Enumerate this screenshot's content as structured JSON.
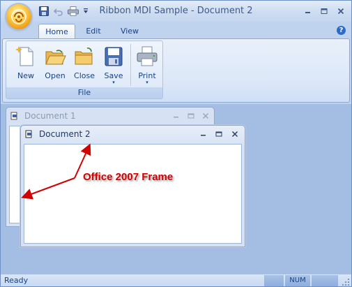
{
  "window": {
    "title": "Ribbon MDI Sample - Document 2"
  },
  "quick_access": {
    "icons": [
      "save-icon",
      "undo-icon",
      "print-icon",
      "customize-dropdown-icon"
    ]
  },
  "tabs": [
    {
      "label": "Home",
      "active": true
    },
    {
      "label": "Edit",
      "active": false
    },
    {
      "label": "View",
      "active": false
    }
  ],
  "ribbon": {
    "group_label": "File",
    "buttons": [
      {
        "label": "New",
        "icon": "new-document-icon"
      },
      {
        "label": "Open",
        "icon": "open-folder-icon"
      },
      {
        "label": "Close",
        "icon": "close-folder-icon"
      },
      {
        "label": "Save",
        "icon": "save-disk-icon",
        "dropdown": "▾"
      },
      {
        "label": "Print",
        "icon": "printer-icon",
        "dropdown": "▾"
      }
    ]
  },
  "mdi": {
    "doc1_title": "Document 1",
    "doc2_title": "Document 2",
    "annotation": "Office 2007 Frame",
    "annotation_color": "#d40000"
  },
  "status": {
    "ready": "Ready",
    "num": "NUM"
  },
  "colors": {
    "accent": "#15428b",
    "frame": "#bfd3ef"
  }
}
